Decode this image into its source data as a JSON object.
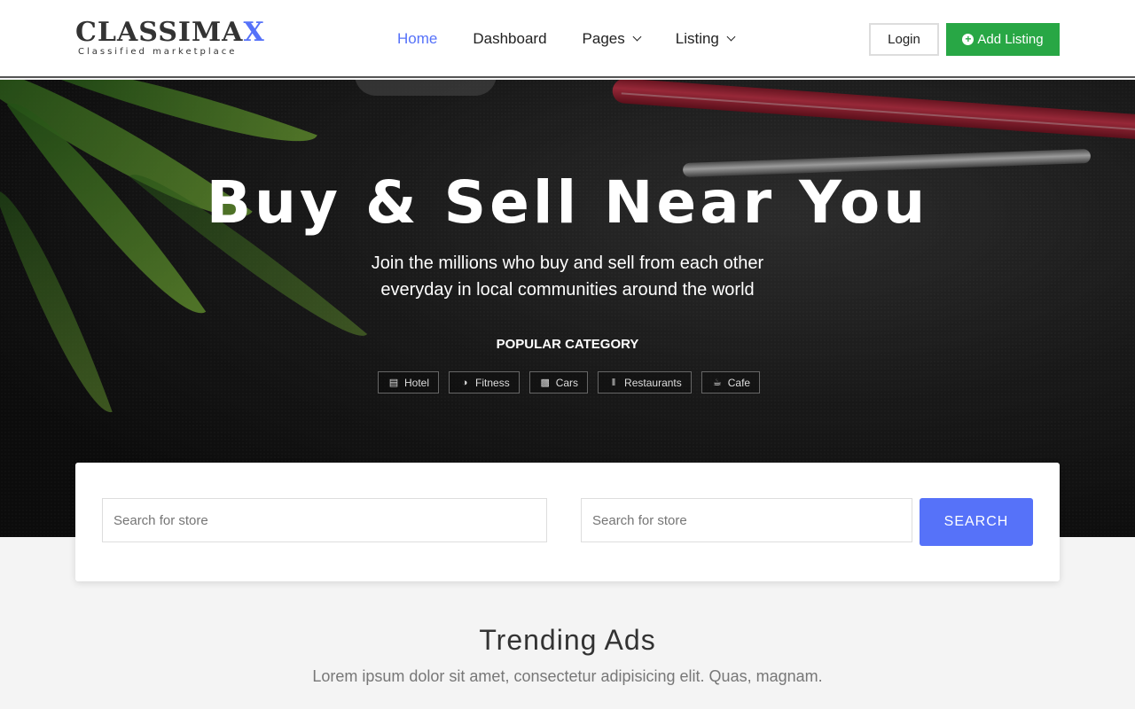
{
  "logo": {
    "main": "CLASSIMA",
    "accent": "X",
    "tagline": "Classified marketplace"
  },
  "nav": {
    "items": [
      {
        "label": "Home",
        "active": true
      },
      {
        "label": "Dashboard",
        "active": false
      },
      {
        "label": "Pages",
        "dropdown": true
      },
      {
        "label": "Listing",
        "dropdown": true
      }
    ]
  },
  "header": {
    "login_label": "Login",
    "add_listing_label": "Add Listing"
  },
  "hero": {
    "title": "Buy & Sell Near You",
    "subtitle_line1": "Join the millions who buy and sell from each other",
    "subtitle_line2": "everyday in local communities around the world",
    "popular_label": "POPULAR CATEGORY",
    "categories": [
      {
        "label": "Hotel",
        "icon": "bed-icon"
      },
      {
        "label": "Fitness",
        "icon": "basketball-icon"
      },
      {
        "label": "Cars",
        "icon": "car-icon"
      },
      {
        "label": "Restaurants",
        "icon": "cutlery-icon"
      },
      {
        "label": "Cafe",
        "icon": "coffee-icon"
      }
    ]
  },
  "search": {
    "placeholder_1": "Search for store",
    "placeholder_2": "Search for store",
    "button_label": "SEARCH"
  },
  "trending": {
    "title": "Trending Ads",
    "subtitle": "Lorem ipsum dolor sit amet, consectetur adipisicing elit. Quas, magnam."
  },
  "colors": {
    "accent": "#5672f9",
    "green": "#28a745"
  }
}
